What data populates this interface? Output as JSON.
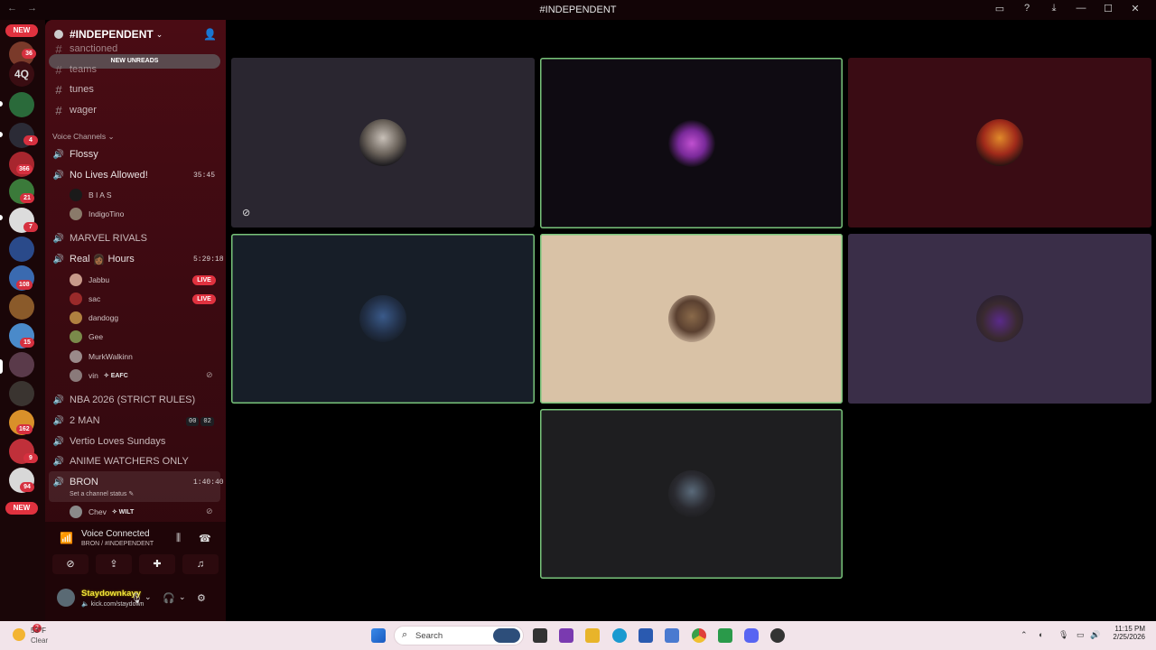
{
  "window": {
    "title": "#INDEPENDENT",
    "nav_back": "←",
    "nav_forward": "→",
    "controls": [
      "▭",
      "?",
      "⤓",
      "—",
      "☐",
      "✕"
    ]
  },
  "rail": {
    "new_top": "NEW",
    "new_bottom": "NEW",
    "text_server": "4Q",
    "badges": [
      "36",
      "4",
      "366",
      "21",
      "7",
      "108",
      "15",
      "162",
      "9",
      "94"
    ]
  },
  "server": {
    "name": "#INDEPENDENT",
    "chevron": "⌄",
    "new_unreads": "NEW UNREADS"
  },
  "text_channels": [
    "sanctioned",
    "teams",
    "tunes",
    "wager"
  ],
  "voice_category": "Voice Channels",
  "voice_channels": {
    "flossy": "Flossy",
    "no_lives": {
      "name": "No Lives Allowed!",
      "time": "35:45"
    },
    "no_lives_users": [
      "B I A S",
      "IndigoTino"
    ],
    "marvel": "MARVEL RIVALS",
    "real_hours": {
      "name": "Real",
      "emoji": "👩🏾",
      "suffix": "Hours",
      "time": "5:29:18"
    },
    "real_users": [
      "Jabbu",
      "sac",
      "dandogg",
      "Gee",
      "MurkWalkinn",
      "vin"
    ],
    "live_label": "LIVE",
    "vin_tag": "EAFC",
    "nba": "NBA 2026 (STRICT RULES)",
    "two_man": {
      "name": "2 MAN",
      "a": "00",
      "b": "02"
    },
    "vertio": "Vertio Loves Sundays",
    "anime": "ANIME WATCHERS ONLY",
    "bron": {
      "name": "BRON",
      "time": "1:40:40",
      "status": "Set a channel status"
    },
    "bron_user": "Chev",
    "bron_tag": "WILT"
  },
  "voice_panel": {
    "title": "Voice Connected",
    "subtitle": "BRON / #INDEPENDENT"
  },
  "me": {
    "name": "Staydownkayy",
    "sub": "kick.com/staydown"
  },
  "colors": {
    "speaking_border": "#78c47a",
    "accent": "#e0323f",
    "sidebar_top": "#4a0c14"
  },
  "taskbar": {
    "temp": "53°F",
    "condition": "Clear",
    "weather_badge": "2",
    "search": "Search",
    "time": "11:15 PM",
    "date": "2/25/2026"
  }
}
